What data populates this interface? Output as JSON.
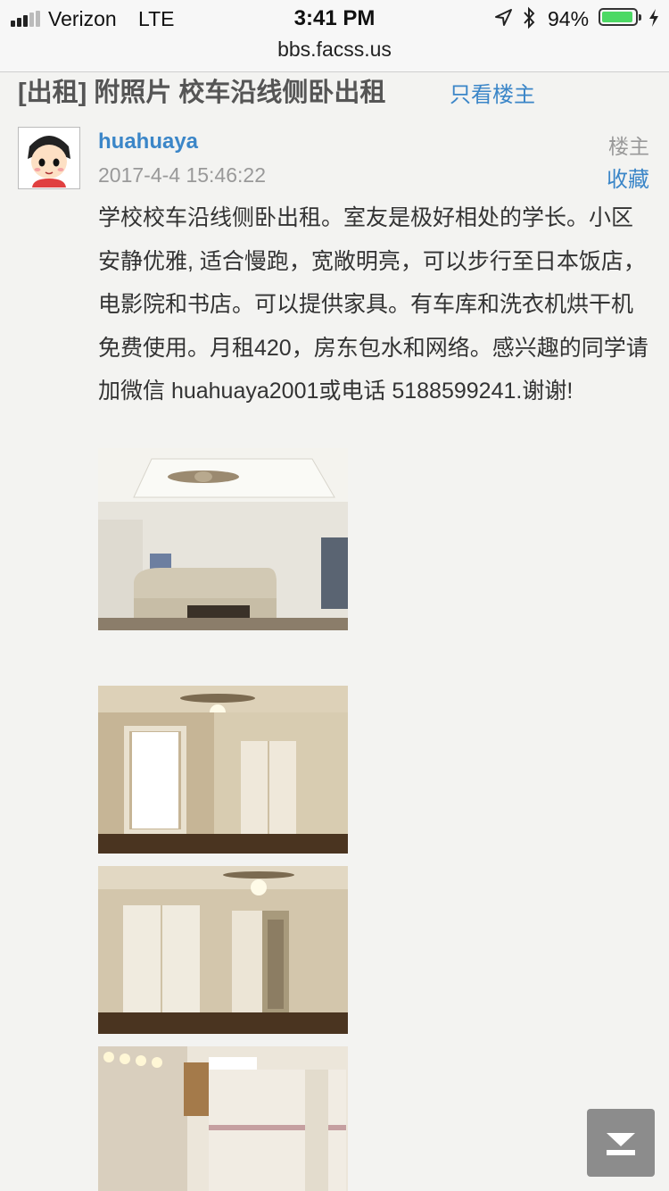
{
  "status_bar": {
    "carrier": "Verizon",
    "network": "LTE",
    "time": "3:41 PM",
    "battery_percent": "94%",
    "battery_level": 0.94,
    "icons": [
      "signal-icon",
      "location-icon",
      "bluetooth-icon",
      "battery-icon",
      "charging-icon"
    ]
  },
  "browser": {
    "url": "bbs.facss.us"
  },
  "thread": {
    "title": "[出租] 附照片 校车沿线侧卧出租",
    "only_op_label": "只看楼主"
  },
  "post": {
    "author": "huahuaya",
    "timestamp": "2017-4-4 15:46:22",
    "op_tag": "楼主",
    "favorite_label": "收藏",
    "body": "学校校车沿线侧卧出租。室友是极好相处的学长。小区安静优雅, 适合慢跑，宽敞明亮，可以步行至日本饭店，电影院和书店。可以提供家具。有车库和洗衣机烘干机免费使用。月租420，房东包水和网络。感兴趣的同学请加微信 huahuaya2001或电话 5188599241.谢谢!",
    "photos": [
      "living-room-photo",
      "bedroom-window-photo",
      "bedroom-closet-photo",
      "bathroom-photo"
    ]
  },
  "controls": {
    "scroll_to_bottom_icon": "scroll-down-icon"
  },
  "colors": {
    "link": "#3b86c8",
    "muted": "#999999",
    "background": "#f3f3f1",
    "battery": "#4cd964"
  }
}
